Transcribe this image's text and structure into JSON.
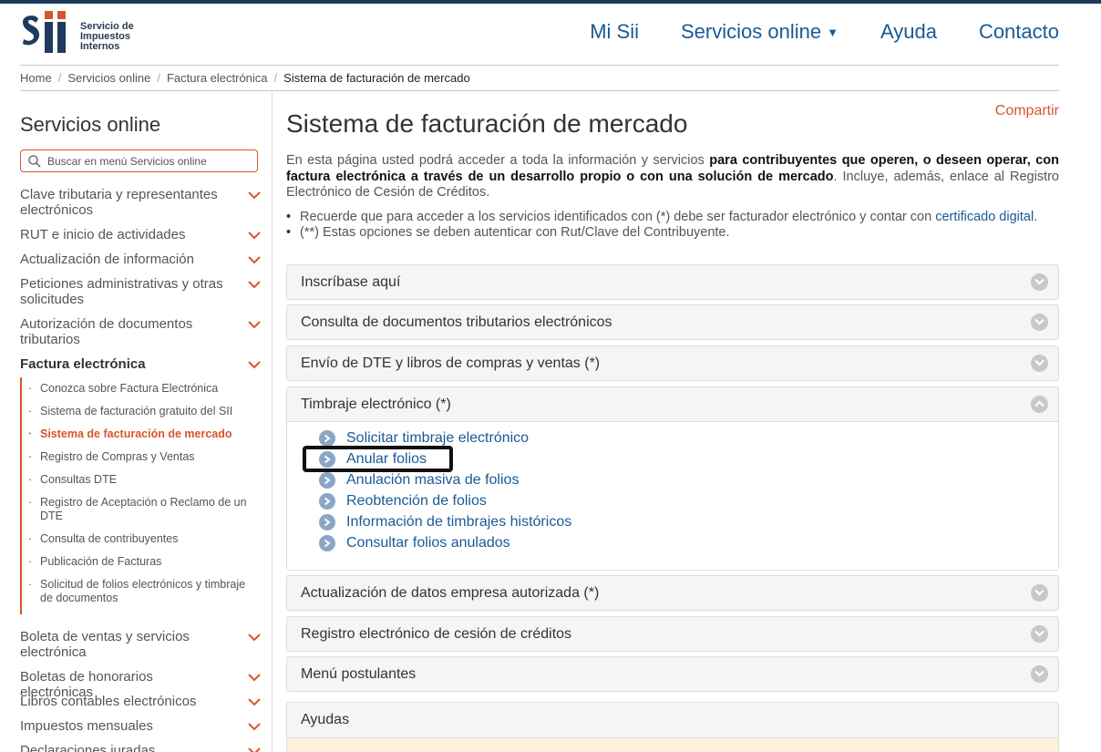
{
  "header": {
    "logo_lines": [
      "Servicio de",
      "Impuestos",
      "Internos"
    ],
    "nav": [
      {
        "label": "Mi Sii"
      },
      {
        "label": "Servicios online",
        "has_caret": true
      },
      {
        "label": "Ayuda"
      },
      {
        "label": "Contacto"
      }
    ]
  },
  "breadcrumb": [
    "Home",
    "Servicios online",
    "Factura electrónica",
    "Sistema de facturación de mercado"
  ],
  "sidebar": {
    "title": "Servicios online",
    "search_placeholder": "Buscar en menú Servicios online",
    "items": [
      "Clave tributaria y representantes electrónicos",
      "RUT e inicio de actividades",
      "Actualización de información",
      "Peticiones administrativas y otras solicitudes",
      "Autorización de documentos tributarios",
      "Factura electrónica",
      "Boleta de ventas y servicios electrónica",
      "Boletas de honorarios electrónicas",
      "Libros contables electrónicos",
      "Impuestos mensuales",
      "Declaraciones juradas"
    ],
    "subitems": [
      "Conozca sobre Factura Electrónica",
      "Sistema de facturación gratuito del SII",
      "Sistema de facturación de mercado",
      "Registro de Compras y Ventas",
      "Consultas DTE",
      "Registro de Aceptación o Reclamo de un DTE",
      "Consulta de contribuyentes",
      "Publicación de Facturas",
      "Solicitud de folios electrónicos y timbraje de documentos"
    ]
  },
  "main": {
    "title": "Sistema de facturación de mercado",
    "share": "Compartir",
    "intro_1": "En esta página usted podrá acceder a toda la información y servicios ",
    "intro_bold": "para contribuyentes que operen, o deseen operar, con factura electrónica a través de un desarrollo propio o con una solución de mercado",
    "intro_2": ". Incluye, además, enlace al Registro Electrónico de Cesión de Créditos.",
    "bullet_1": "Recuerde que para acceder a los servicios identificados con (*) debe ser facturador electrónico y contar con ",
    "bullet_1_link": "certificado digital",
    "bullet_1_end": ".",
    "bullet_2": "(**) Estas opciones se deben autenticar con Rut/Clave del Contribuyente.",
    "accordions": [
      "Inscríbase aquí",
      "Consulta de documentos tributarios electrónicos",
      "Envío de DTE y libros de compras y ventas (*)",
      "Timbraje electrónico (*)",
      "Actualización de datos empresa autorizada (*)",
      "Registro electrónico de cesión de créditos",
      "Menú postulantes",
      "Ayudas"
    ],
    "timbraje_links": [
      "Solicitar timbraje electrónico",
      "Anular folios",
      "Anulación masiva de folios",
      "Reobtención de folios",
      "Información de timbrajes históricos",
      "Consultar folios anulados"
    ]
  },
  "colors": {
    "accent": "#d9552b",
    "link": "#1a5a96",
    "brand": "#1e3a5f"
  }
}
